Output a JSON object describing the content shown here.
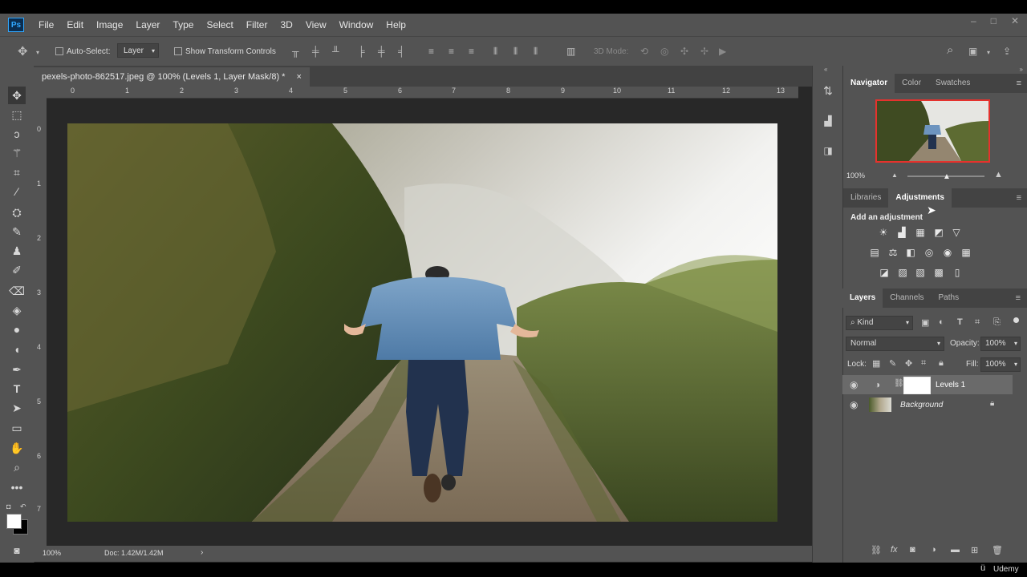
{
  "app": {
    "logo": "Ps"
  },
  "menu": [
    "File",
    "Edit",
    "Image",
    "Layer",
    "Type",
    "Select",
    "Filter",
    "3D",
    "View",
    "Window",
    "Help"
  ],
  "window_controls": {
    "minimize": "–",
    "maximize": "□",
    "close": "✕"
  },
  "options": {
    "auto_select_label": "Auto-Select:",
    "auto_select_value": "Layer",
    "show_transform_label": "Show Transform Controls",
    "mode_label": "3D Mode:"
  },
  "document": {
    "tab_title": "pexels-photo-862517.jpeg @ 100% (Levels 1, Layer Mask/8) *",
    "close_glyph": "×",
    "zoom": "100%",
    "doc_size": "Doc: 1.42M/1.42M"
  },
  "rulers": {
    "horizontal": [
      "0",
      "1",
      "2",
      "3",
      "4",
      "5",
      "6",
      "7",
      "8",
      "9",
      "10",
      "11",
      "12",
      "13"
    ],
    "vertical": [
      "0",
      "1",
      "2",
      "3",
      "4",
      "5",
      "6",
      "7"
    ]
  },
  "navigator": {
    "tabs": [
      "Navigator",
      "Color",
      "Swatches"
    ],
    "zoom": "100%"
  },
  "adjustments": {
    "tabs": [
      "Libraries",
      "Adjustments"
    ],
    "heading": "Add an adjustment",
    "row1": [
      "☀",
      "▟",
      "▦",
      "◩",
      "▽"
    ],
    "row2": [
      "▤",
      "⚖",
      "◧",
      "◎",
      "◉",
      "▦"
    ],
    "row3": [
      "◪",
      "▨",
      "▧",
      "▩",
      "▯"
    ]
  },
  "layers": {
    "tabs": [
      "Layers",
      "Channels",
      "Paths"
    ],
    "filter_kind": "Kind",
    "blend_mode": "Normal",
    "opacity_label": "Opacity:",
    "opacity": "100%",
    "lock_label": "Lock:",
    "fill_label": "Fill:",
    "fill": "100%",
    "items": [
      {
        "name": "Levels 1",
        "selected": true
      },
      {
        "name": "Background",
        "selected": false
      }
    ]
  },
  "watermark": "Udemy",
  "colors": {
    "accent": "#31a8ff",
    "nav_box": "#e5322d",
    "panel": "#535353",
    "dark": "#282828"
  }
}
